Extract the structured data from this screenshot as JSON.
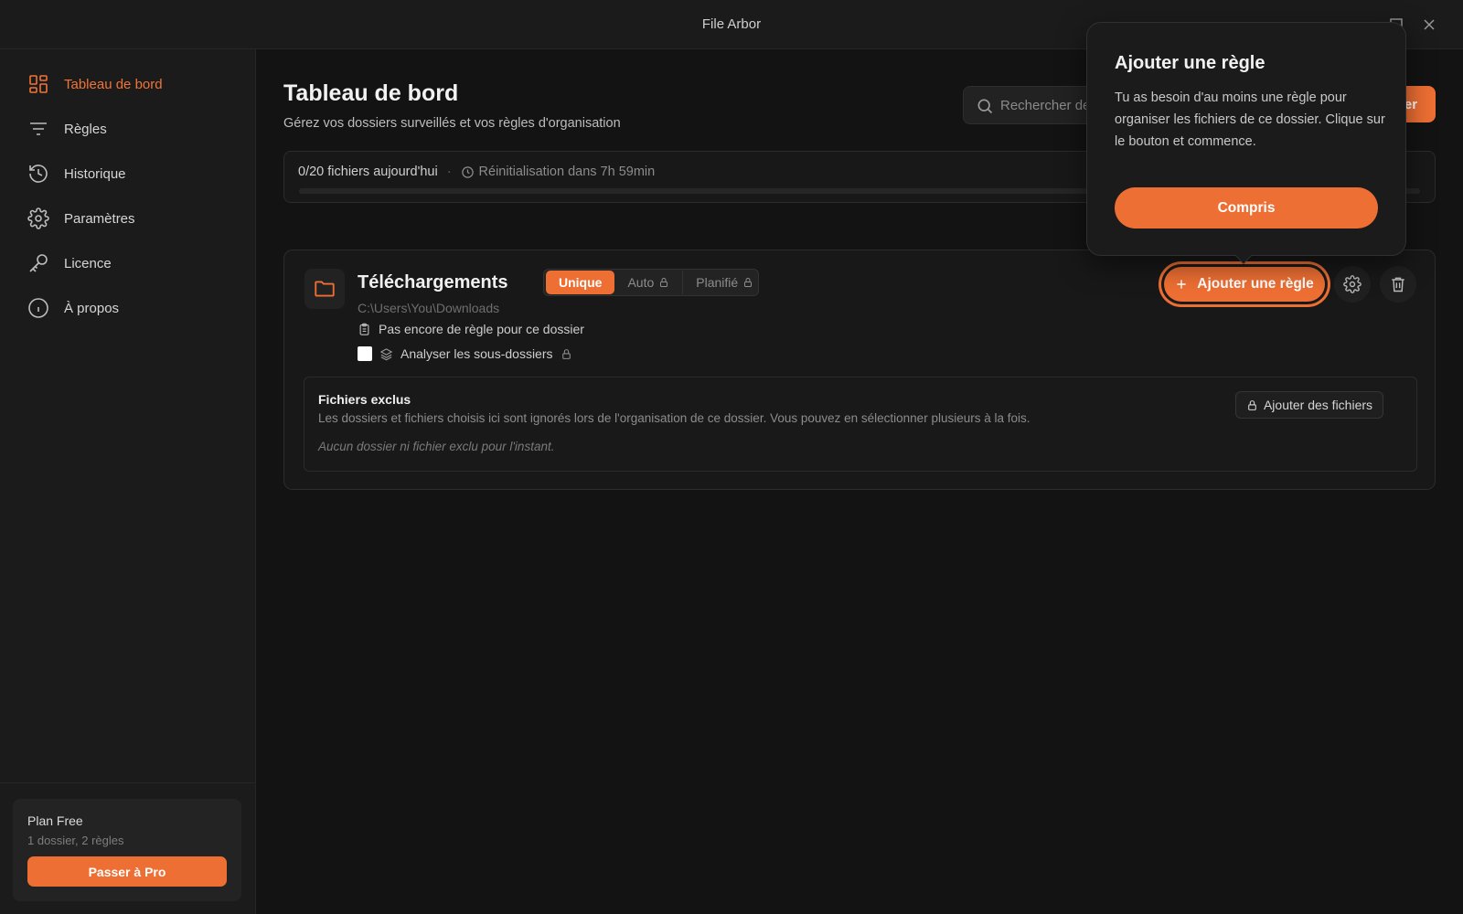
{
  "app": {
    "title": "File Arbor",
    "accent": "#ee6f33"
  },
  "sidebar": {
    "items": [
      {
        "label": "Tableau de bord",
        "icon": "dashboard-icon",
        "active": true
      },
      {
        "label": "Règles",
        "icon": "filter-icon",
        "active": false
      },
      {
        "label": "Historique",
        "icon": "history-icon",
        "active": false
      },
      {
        "label": "Paramètres",
        "icon": "gear-icon",
        "active": false
      },
      {
        "label": "Licence",
        "icon": "key-icon",
        "active": false
      },
      {
        "label": "À propos",
        "icon": "info-icon",
        "active": false
      }
    ],
    "plan": {
      "title": "Plan Free",
      "usage": "1 dossier, 2 règles",
      "upgrade_label": "Passer à Pro"
    }
  },
  "header": {
    "title": "Tableau de bord",
    "subtitle": "Gérez vos dossiers surveillés et vos règles d'organisation",
    "search_placeholder": "Rechercher de",
    "add_folder_label": "er"
  },
  "quota": {
    "files_text": "0/20 fichiers aujourd'hui",
    "separator": "·",
    "reset_text": "Réinitialisation dans 7h 59min",
    "progress": 0.0
  },
  "folder": {
    "name": "Téléchargements",
    "path": "C:\\Users\\You\\Downloads",
    "modes": [
      {
        "label": "Unique",
        "active": true,
        "locked": false
      },
      {
        "label": "Auto",
        "active": false,
        "locked": true
      },
      {
        "label": "Planifié",
        "active": false,
        "locked": true
      }
    ],
    "rule_status": "Pas encore de règle pour ce dossier",
    "subfolders_label": "Analyser les sous-dossiers",
    "subfolders_checked": false,
    "add_rule_label": "Ajouter une règle",
    "excluded": {
      "title": "Fichiers exclus",
      "description": "Les dossiers et fichiers choisis ici sont ignorés lors de l'organisation de ce dossier. Vous pouvez en sélectionner plusieurs à la fois.",
      "empty": "Aucun dossier ni fichier exclu pour l'instant.",
      "add_label": "Ajouter des fichiers"
    }
  },
  "popover": {
    "title": "Ajouter une règle",
    "body": "Tu as besoin d'au moins une règle pour organiser les fichiers de ce dossier. Clique sur le bouton et commence.",
    "button_label": "Compris"
  }
}
